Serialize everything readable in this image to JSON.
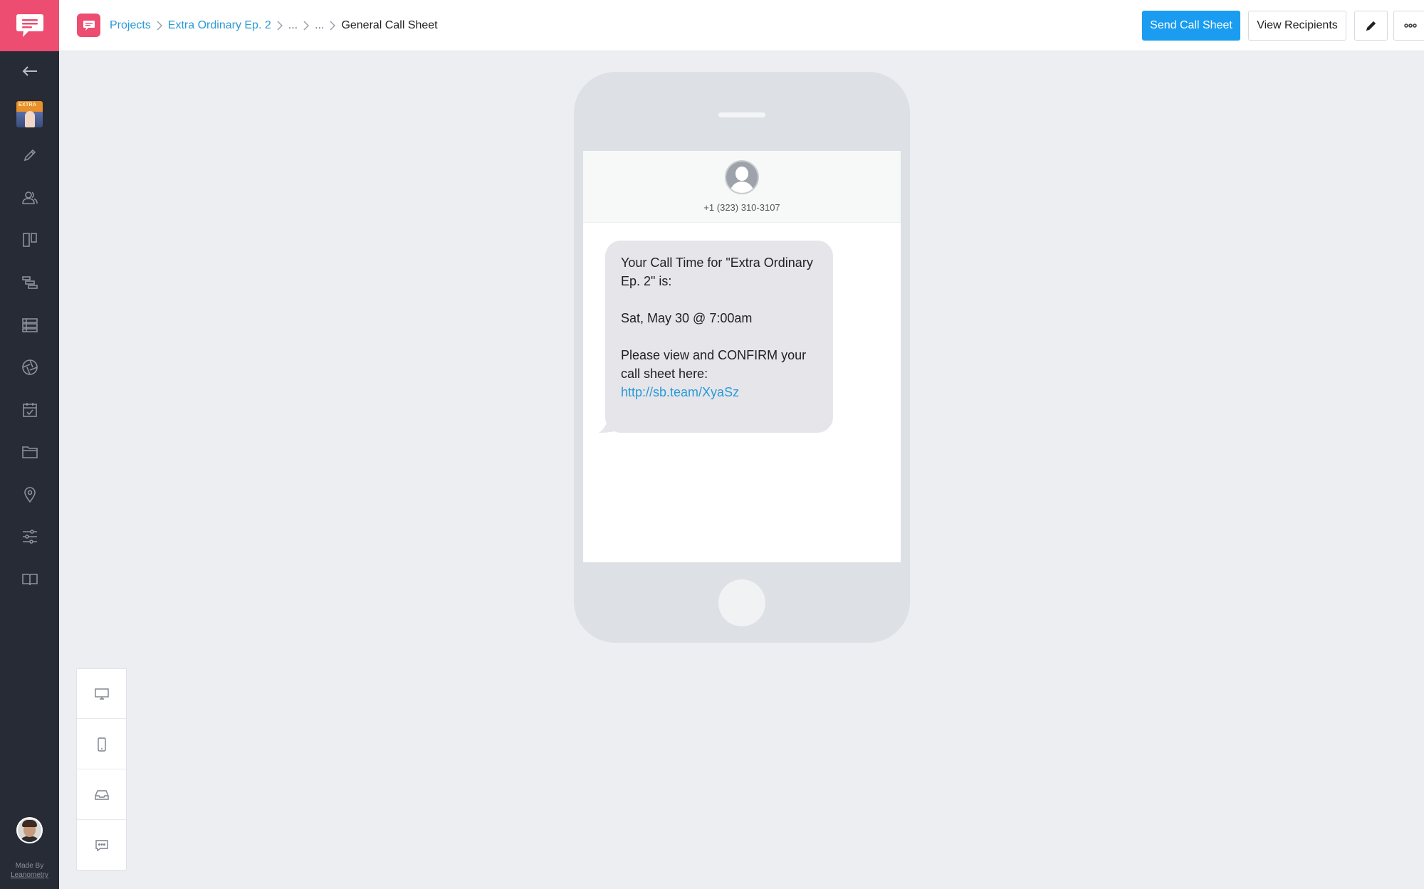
{
  "sidebar": {
    "made_by_label": "Made By",
    "made_by_brand": "Leanometry",
    "project_thumb_text": "EXTRA"
  },
  "breadcrumb": {
    "items": [
      "Projects",
      "Extra Ordinary Ep. 2",
      "...",
      "...",
      "General Call Sheet"
    ]
  },
  "toolbar": {
    "send_label": "Send Call Sheet",
    "view_recipients_label": "View Recipients"
  },
  "message": {
    "phone_number": "+1 (323) 310-3107",
    "line1": "Your Call Time for \"Extra Ordinary Ep. 2\" is:",
    "line2": "Sat, May 30 @ 7:00am",
    "line3": "Please view and CONFIRM your call sheet here:",
    "url": "http://sb.team/XyaSz"
  },
  "colors": {
    "accent": "#ec4d71",
    "primary_button": "#1a9cf0",
    "link": "#2b9ad6",
    "sidebar_bg": "#272b35"
  }
}
